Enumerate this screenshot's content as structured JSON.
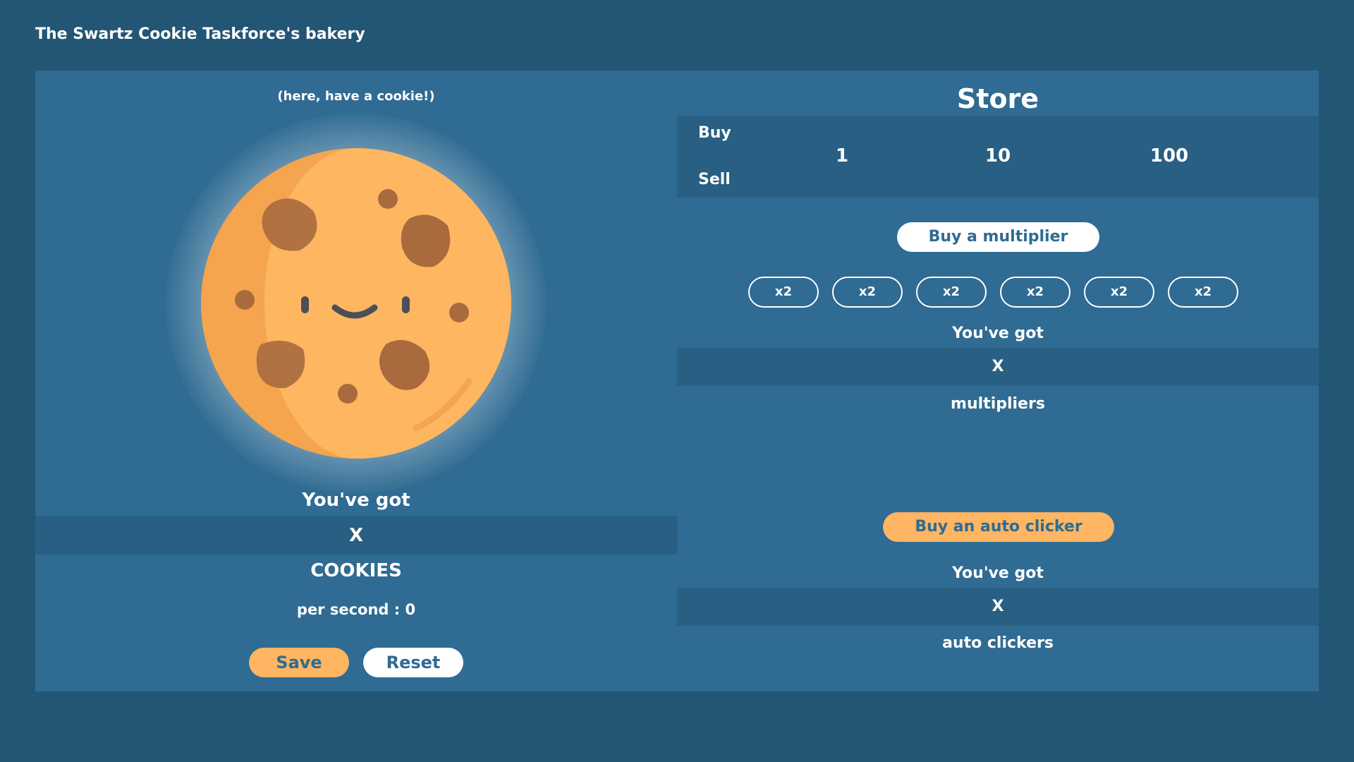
{
  "header": {
    "title": "The Swartz Cookie Taskforce's bakery"
  },
  "left": {
    "hint": "(here, have a cookie!)",
    "youve_got": "You've got",
    "count": "X",
    "unit": "COOKIES",
    "per_second": "per second : 0",
    "save_label": "Save",
    "reset_label": "Reset"
  },
  "store": {
    "title": "Store",
    "buy_label": "Buy",
    "sell_label": "Sell",
    "quantities": [
      "1",
      "10",
      "100"
    ],
    "multiplier_button": "Buy a multiplier",
    "multipliers": [
      "x2",
      "x2",
      "x2",
      "x2",
      "x2",
      "x2"
    ],
    "mult_youve_got": "You've got",
    "mult_count": "X",
    "mult_unit": "multipliers",
    "autoclicker_button": "Buy an auto clicker",
    "auto_youve_got": "You've got",
    "auto_count": "X",
    "auto_unit": "auto clickers"
  },
  "colors": {
    "background": "#235675",
    "panel": "#2f6b92",
    "band": "#285f82",
    "accent_orange": "#ffb561",
    "cookie": "#ffb661",
    "cookie_shade": "#f4a54e",
    "chip": "#a96a3e"
  },
  "icons": {
    "cookie": "cookie-icon"
  }
}
